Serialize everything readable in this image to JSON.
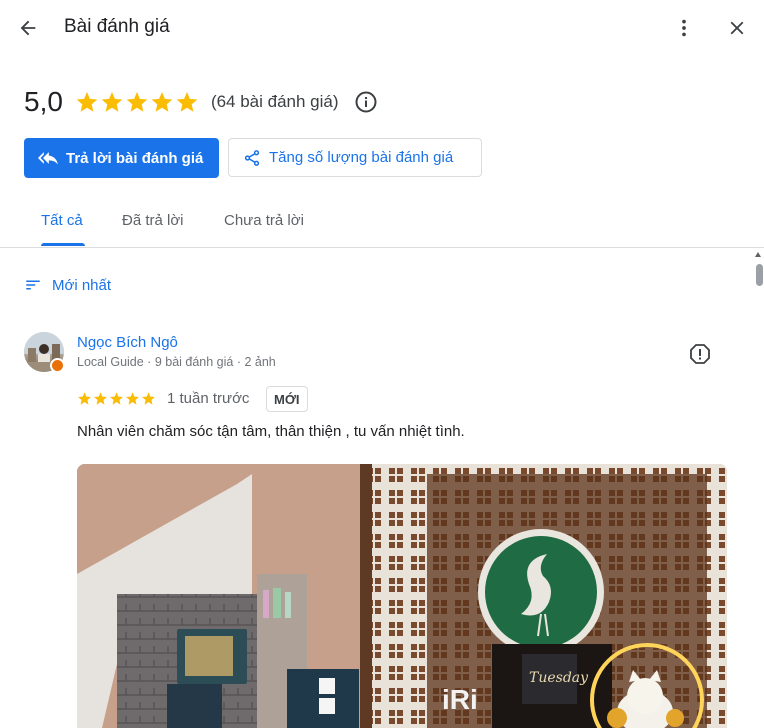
{
  "header": {
    "title": "Bài đánh giá",
    "back_icon": "arrow-back-icon",
    "more_icon": "more-vert-icon",
    "close_icon": "close-icon"
  },
  "summary": {
    "rating": "5,0",
    "stars": 5,
    "count_text": "(64 bài đánh giá)",
    "info_icon": "info-icon",
    "star_color": "#fbbc04"
  },
  "actions": {
    "reply_label": "Trả lời bài đánh giá",
    "increase_label": "Tăng số lượng bài đánh giá",
    "primary_color": "#1a73e8"
  },
  "tabs": [
    {
      "label": "Tất cả",
      "active": true
    },
    {
      "label": "Đã trả lời",
      "active": false
    },
    {
      "label": "Chưa trả lời",
      "active": false
    }
  ],
  "sort": {
    "label": "Mới nhất",
    "icon": "sort-icon"
  },
  "reviews": [
    {
      "name": "Ngọc Bích Ngô",
      "meta": "Local Guide · 9 bài đánh giá · 2 ảnh",
      "stars": 5,
      "time": "1 tuần trước",
      "badge": "MỚI",
      "text": "Nhân viên chăm sóc tận tâm, thân thiện , tu vấn nhiệt tình.",
      "photo_sign_text": "iRi",
      "photo_tag_text": "Tuesday"
    }
  ]
}
